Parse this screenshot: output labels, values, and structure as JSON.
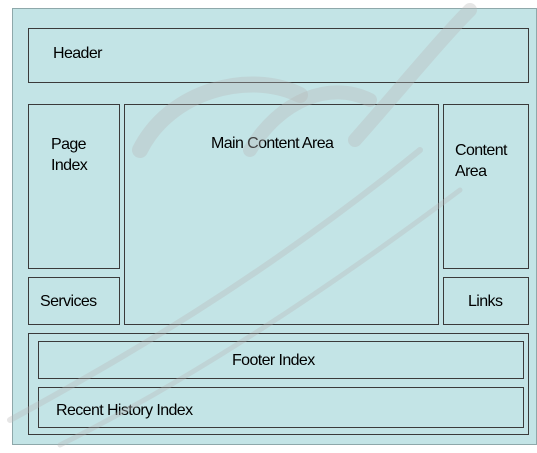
{
  "layout": {
    "header": "Header",
    "page_index": "Page\nIndex",
    "main_content": "Main Content Area",
    "content_area": "Content\nArea",
    "services": "Services",
    "links": "Links",
    "footer_index": "Footer Index",
    "recent_history": "Recent History Index"
  },
  "colors": {
    "box_fill": "#c3e4e6",
    "border": "#3a3a3a",
    "watermark": "#b8b8b8"
  }
}
